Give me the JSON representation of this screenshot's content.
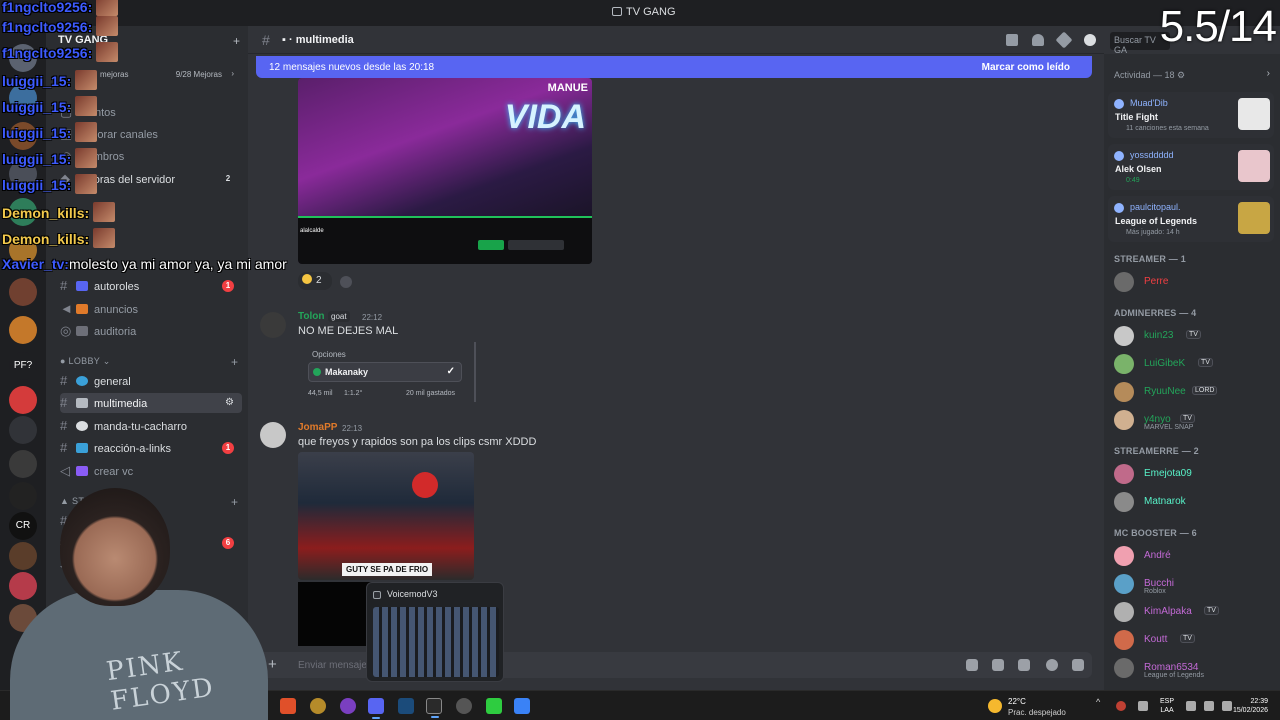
{
  "window": {
    "title": "TV GANG"
  },
  "overlay_counter": "5.5/14",
  "server": {
    "name": "TV GANG",
    "boost": {
      "label": "mejoras",
      "progress": "9/28 Mejoras"
    }
  },
  "overlay_chat": [
    {
      "user": "f1ngclto9256:",
      "msg": "",
      "color": "blue"
    },
    {
      "user": "f1ngclto9256:",
      "msg": "",
      "color": "blue"
    },
    {
      "user": "f1ngclto9256:",
      "msg": "",
      "color": "blue"
    },
    {
      "user": "luiggii_15:",
      "msg": "",
      "color": "blue"
    },
    {
      "user": "luiggii_15:",
      "msg": "",
      "color": "blue"
    },
    {
      "user": "luiggii_15:",
      "msg": "",
      "color": "blue"
    },
    {
      "user": "luiggii_15:",
      "msg": "",
      "color": "blue"
    },
    {
      "user": "luiggii_15:",
      "msg": "",
      "color": "blue"
    },
    {
      "user": "Demon_kills:",
      "msg": "",
      "color": "yellow"
    },
    {
      "user": "Demon_kills:",
      "msg": "",
      "color": "yellow"
    },
    {
      "user": "Xavier_tv:",
      "msg": "molesto ya mi amor ya, ya mi amor",
      "color": "blue"
    }
  ],
  "channels_top": [
    {
      "label": "Eventos"
    },
    {
      "label": "Explorar canales"
    },
    {
      "label": "Miembros"
    },
    {
      "label": "Mejoras del servidor",
      "count": "2"
    }
  ],
  "channels_info": [
    {
      "label": "autoroles",
      "count": "1"
    },
    {
      "label": "anuncios"
    },
    {
      "label": "auditoria"
    }
  ],
  "category_lobby": "LOBBY",
  "channels_lobby": [
    {
      "label": "general"
    },
    {
      "label": "multimedia"
    },
    {
      "label": "manda-tu-cacharro"
    },
    {
      "label": "reacción-a-links",
      "count": "1"
    },
    {
      "label": "crear vc"
    }
  ],
  "category_staff": "STAFF",
  "channels_staff": [
    {
      "label": "sta"
    },
    {
      "label": "lo",
      "count": "6"
    },
    {
      "label": "sta"
    }
  ],
  "header": {
    "channel": "multimedia",
    "search_placeholder": "Buscar TV GA"
  },
  "banner": {
    "text": "12 mensajes nuevos desde las 20:18",
    "action": "Marcar como leído"
  },
  "stream_clip": {
    "brand_top": "MANUE",
    "brand": "VIDA",
    "streamer": "alalcalde"
  },
  "reaction": {
    "count": "2"
  },
  "messages": [
    {
      "author": "Tolon",
      "tag": "goat",
      "time": "22:12",
      "text": "NO ME DEJES MAL",
      "poll": {
        "header": "Opciones",
        "option": "Makanaky",
        "stat1": "44,5 mil",
        "stat2": "1:1.2°",
        "stat3": "20 mil gastados"
      }
    },
    {
      "author": "JomaPP",
      "time": "22:13",
      "text": "que freyos y rapidos son pa los clips csmr XDDD",
      "caption": "GUTY SE PA DE FRIO"
    }
  ],
  "voicemod": {
    "title": "VoicemodV3"
  },
  "composer": {
    "placeholder": "Enviar mensaje"
  },
  "members": {
    "activity_header": "Actividad — 18",
    "activities": [
      {
        "user": "Muad'Dib",
        "title": "Title Fight",
        "sub": "11 canciones esta semana",
        "thumb_color": "#e8e8e8"
      },
      {
        "user": "yossddddd",
        "title": "Alek Olsen",
        "sub": "0:49",
        "thumb_color": "#e9c6cc"
      },
      {
        "user": "paulcitopaul.",
        "title": "League of Legends",
        "sub": "Más jugado: 14 h",
        "thumb_color": "#c8a644"
      }
    ],
    "groups": [
      {
        "name": "STREAMER — 1",
        "members": [
          {
            "name": "Perre",
            "color": "#f23f42"
          }
        ]
      },
      {
        "name": "ADMINERRES — 4",
        "members": [
          {
            "name": "kuin23",
            "color": "#23a55a",
            "tag": "TV"
          },
          {
            "name": "LuiGibeK",
            "color": "#23a55a",
            "tag": "TV"
          },
          {
            "name": "RyuuNee",
            "color": "#23a55a",
            "tag": "LORD"
          },
          {
            "name": "y4nyo",
            "color": "#23a55a",
            "tag": "TV",
            "sub": "MARVEL SNAP"
          }
        ]
      },
      {
        "name": "STREAMERRE — 2",
        "members": [
          {
            "name": "Emejota09",
            "color": "#58f2c8"
          },
          {
            "name": "Matnarok",
            "color": "#58f2c8"
          }
        ]
      },
      {
        "name": "MC BOOSTER — 6",
        "members": [
          {
            "name": "André",
            "color": "#c36ad6"
          },
          {
            "name": "Bucchi",
            "color": "#c36ad6",
            "sub": "Roblox"
          },
          {
            "name": "KimAlpaka",
            "color": "#c36ad6",
            "tag": "TV"
          },
          {
            "name": "Koutt",
            "color": "#c36ad6",
            "tag": "TV"
          },
          {
            "name": "Roman6534",
            "color": "#c36ad6",
            "sub": "League of Legends"
          }
        ]
      }
    ]
  },
  "taskbar": {
    "weather_temp": "22°C",
    "weather_desc": "Prac. despejado",
    "lang1": "ESP",
    "lang2": "LAA",
    "time": "22:39",
    "date": "15/02/2026"
  }
}
